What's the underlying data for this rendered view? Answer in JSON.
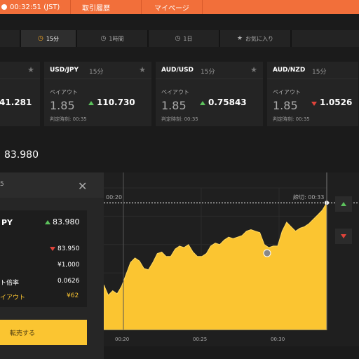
{
  "topbar": {
    "clock": "00:32:51 (JST)",
    "nav": [
      "取引履歴",
      "マイページ"
    ]
  },
  "tabs": [
    {
      "label": "15分",
      "icon": "clock-icon",
      "active": true
    },
    {
      "label": "1時間",
      "icon": "clock-icon",
      "active": false
    },
    {
      "label": "1日",
      "icon": "clock-icon",
      "active": false
    },
    {
      "label": "お気に入り",
      "icon": "star-icon",
      "active": false
    }
  ],
  "cards": [
    {
      "pair": "",
      "timeframe": "",
      "payout_label": "",
      "payout": "",
      "direction": "",
      "rate": "41.281",
      "judge": ""
    },
    {
      "pair": "USD/JPY",
      "timeframe": "15分",
      "payout_label": "ペイアウト",
      "payout": "1.85",
      "direction": "up",
      "rate": "110.730",
      "judge": "判定時刻: 00:35"
    },
    {
      "pair": "AUD/USD",
      "timeframe": "15分",
      "payout_label": "ペイアウト",
      "payout": "1.85",
      "direction": "up",
      "rate": "0.75843",
      "judge": "判定時刻: 00:35"
    },
    {
      "pair": "AUD/NZD",
      "timeframe": "15分",
      "payout_label": "ペイアウト",
      "payout": "1.85",
      "direction": "down",
      "rate": "1.0526",
      "judge": "判定時刻: 00:35"
    }
  ],
  "price_header": "83.980",
  "panel": {
    "title_fragment": "5",
    "symbol": "PY",
    "symbol_rate": "83.980",
    "entry_rate": "83.950",
    "amount": "¥1,000",
    "multiplier_label": "ト倍率",
    "multiplier": "0.0626",
    "payout_label": "イアウト",
    "payout": "¥62",
    "sell_button": "転売する"
  },
  "chart_data": {
    "type": "area",
    "x_ticks": [
      "00:20",
      "00:25",
      "00:30"
    ],
    "top_labels": {
      "start": "00:20",
      "deadline": "締切: 00:33"
    },
    "current_rate": 83.98,
    "entry_rate": 83.95,
    "fill_color": "#fbc531",
    "series": [
      {
        "values": [
          83.925,
          83.918,
          83.921,
          83.919,
          83.924,
          83.932,
          83.94,
          83.943,
          83.941,
          83.936,
          83.935,
          83.94,
          83.946,
          83.947,
          83.944,
          83.944,
          83.949,
          83.951,
          83.95,
          83.952,
          83.947,
          83.944,
          83.944,
          83.946,
          83.951,
          83.953,
          83.952,
          83.955,
          83.957,
          83.956,
          83.957,
          83.958,
          83.961,
          83.962,
          83.961,
          83.96,
          83.952,
          83.95,
          83.951,
          83.951,
          83.961,
          83.967,
          83.964,
          83.961,
          83.963,
          83.964,
          83.966,
          83.969,
          83.972,
          83.975,
          83.98
        ]
      }
    ]
  }
}
